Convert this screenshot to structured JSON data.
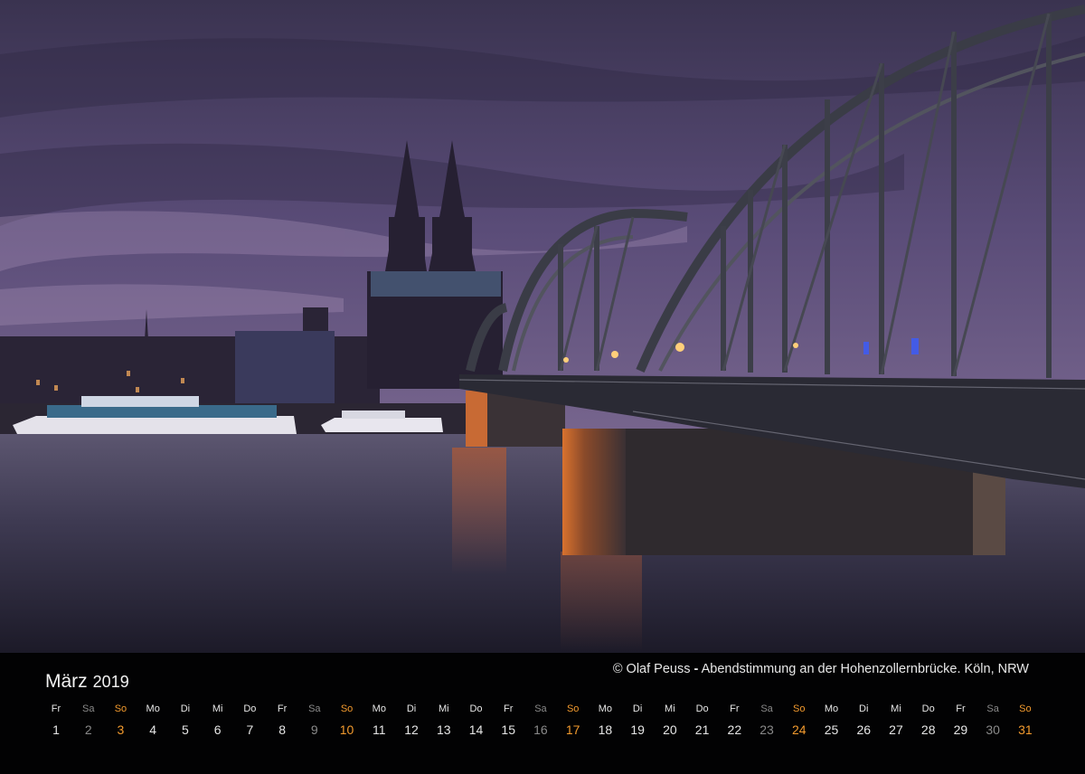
{
  "caption": {
    "author": "© Olaf Peuss",
    "separator": "-",
    "description": "Abendstimmung an der Hohenzollernbrücke. Köln, NRW"
  },
  "calendar": {
    "month": "März",
    "year": "2019",
    "days": [
      {
        "wd": "Fr",
        "n": "1"
      },
      {
        "wd": "Sa",
        "n": "2"
      },
      {
        "wd": "So",
        "n": "3"
      },
      {
        "wd": "Mo",
        "n": "4"
      },
      {
        "wd": "Di",
        "n": "5"
      },
      {
        "wd": "Mi",
        "n": "6"
      },
      {
        "wd": "Do",
        "n": "7"
      },
      {
        "wd": "Fr",
        "n": "8"
      },
      {
        "wd": "Sa",
        "n": "9"
      },
      {
        "wd": "So",
        "n": "10"
      },
      {
        "wd": "Mo",
        "n": "11"
      },
      {
        "wd": "Di",
        "n": "12"
      },
      {
        "wd": "Mi",
        "n": "13"
      },
      {
        "wd": "Do",
        "n": "14"
      },
      {
        "wd": "Fr",
        "n": "15"
      },
      {
        "wd": "Sa",
        "n": "16"
      },
      {
        "wd": "So",
        "n": "17"
      },
      {
        "wd": "Mo",
        "n": "18"
      },
      {
        "wd": "Di",
        "n": "19"
      },
      {
        "wd": "Mi",
        "n": "20"
      },
      {
        "wd": "Do",
        "n": "21"
      },
      {
        "wd": "Fr",
        "n": "22"
      },
      {
        "wd": "Sa",
        "n": "23"
      },
      {
        "wd": "So",
        "n": "24"
      },
      {
        "wd": "Mo",
        "n": "25"
      },
      {
        "wd": "Di",
        "n": "26"
      },
      {
        "wd": "Mi",
        "n": "27"
      },
      {
        "wd": "Do",
        "n": "28"
      },
      {
        "wd": "Fr",
        "n": "29"
      },
      {
        "wd": "Sa",
        "n": "30"
      },
      {
        "wd": "So",
        "n": "31"
      }
    ]
  },
  "colors": {
    "weekday": "#e6e6e6",
    "saturday": "#8a8a8a",
    "sunday": "#f29a2e",
    "background": "#020203"
  }
}
